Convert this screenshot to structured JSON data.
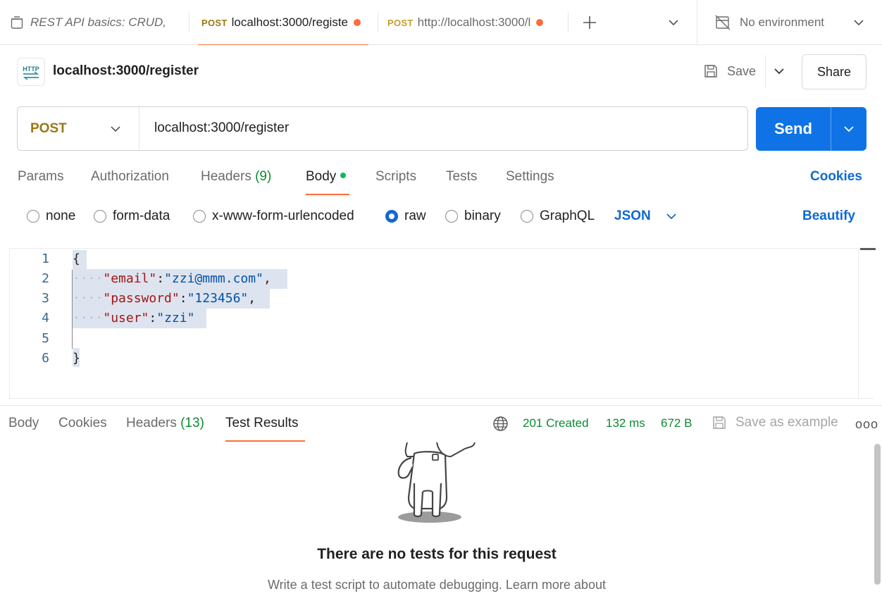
{
  "tabs": [
    {
      "label": "REST API basics: CRUD,",
      "method": "",
      "dirty": false,
      "italic": true
    },
    {
      "label": "localhost:3000/registe",
      "method": "POST",
      "dirty": true,
      "active": true
    },
    {
      "label": "http://localhost:3000/l",
      "method": "POST",
      "dirty": true
    }
  ],
  "environment": {
    "label": "No environment"
  },
  "request": {
    "title": "localhost:3000/register",
    "badge": "HTTP",
    "save_label": "Save",
    "share_label": "Share",
    "method": "POST",
    "url": "localhost:3000/register",
    "send_label": "Send"
  },
  "request_tabs": {
    "params": "Params",
    "authorization": "Authorization",
    "headers": "Headers",
    "headers_count": "(9)",
    "body": "Body",
    "scripts": "Scripts",
    "tests": "Tests",
    "settings": "Settings",
    "cookies": "Cookies"
  },
  "body_types": {
    "none": "none",
    "form_data": "form-data",
    "urlencoded": "x-www-form-urlencoded",
    "raw": "raw",
    "binary": "binary",
    "graphql": "GraphQL",
    "selected": "raw",
    "format": "JSON",
    "beautify": "Beautify"
  },
  "editor": {
    "line_numbers": [
      "1",
      "2",
      "3",
      "4",
      "5",
      "6"
    ],
    "open_brace": "{",
    "close_brace": "}",
    "indent": "····",
    "fields": [
      {
        "key": "\"email\"",
        "value": "\"zzi@mmm.com\"",
        "comma": ","
      },
      {
        "key": "\"password\"",
        "value": "\"123456\"",
        "comma": ","
      },
      {
        "key": "\"user\"",
        "value": "\"zzi\"",
        "comma": ""
      }
    ]
  },
  "response": {
    "tabs": {
      "body": "Body",
      "cookies": "Cookies",
      "headers": "Headers",
      "headers_count": "(13)",
      "test_results": "Test Results"
    },
    "status": "201 Created",
    "time": "132 ms",
    "size": "672 B",
    "save_example": "Save as example",
    "more": "ooo",
    "empty_title": "There are no tests for this request",
    "empty_subtitle": "Write a test script to automate debugging. Learn more about"
  },
  "colors": {
    "accent": "#ff6c37",
    "send": "#0f73e6",
    "link": "#0f6ad1",
    "status_ok": "#0c8a32",
    "method_post": "#9c7712"
  },
  "icons": [
    "trash-icon",
    "plus-icon",
    "chevron-down-icon",
    "no-environment-icon",
    "http-icon",
    "save-icon",
    "globe-icon",
    "astronaut-illustration"
  ]
}
